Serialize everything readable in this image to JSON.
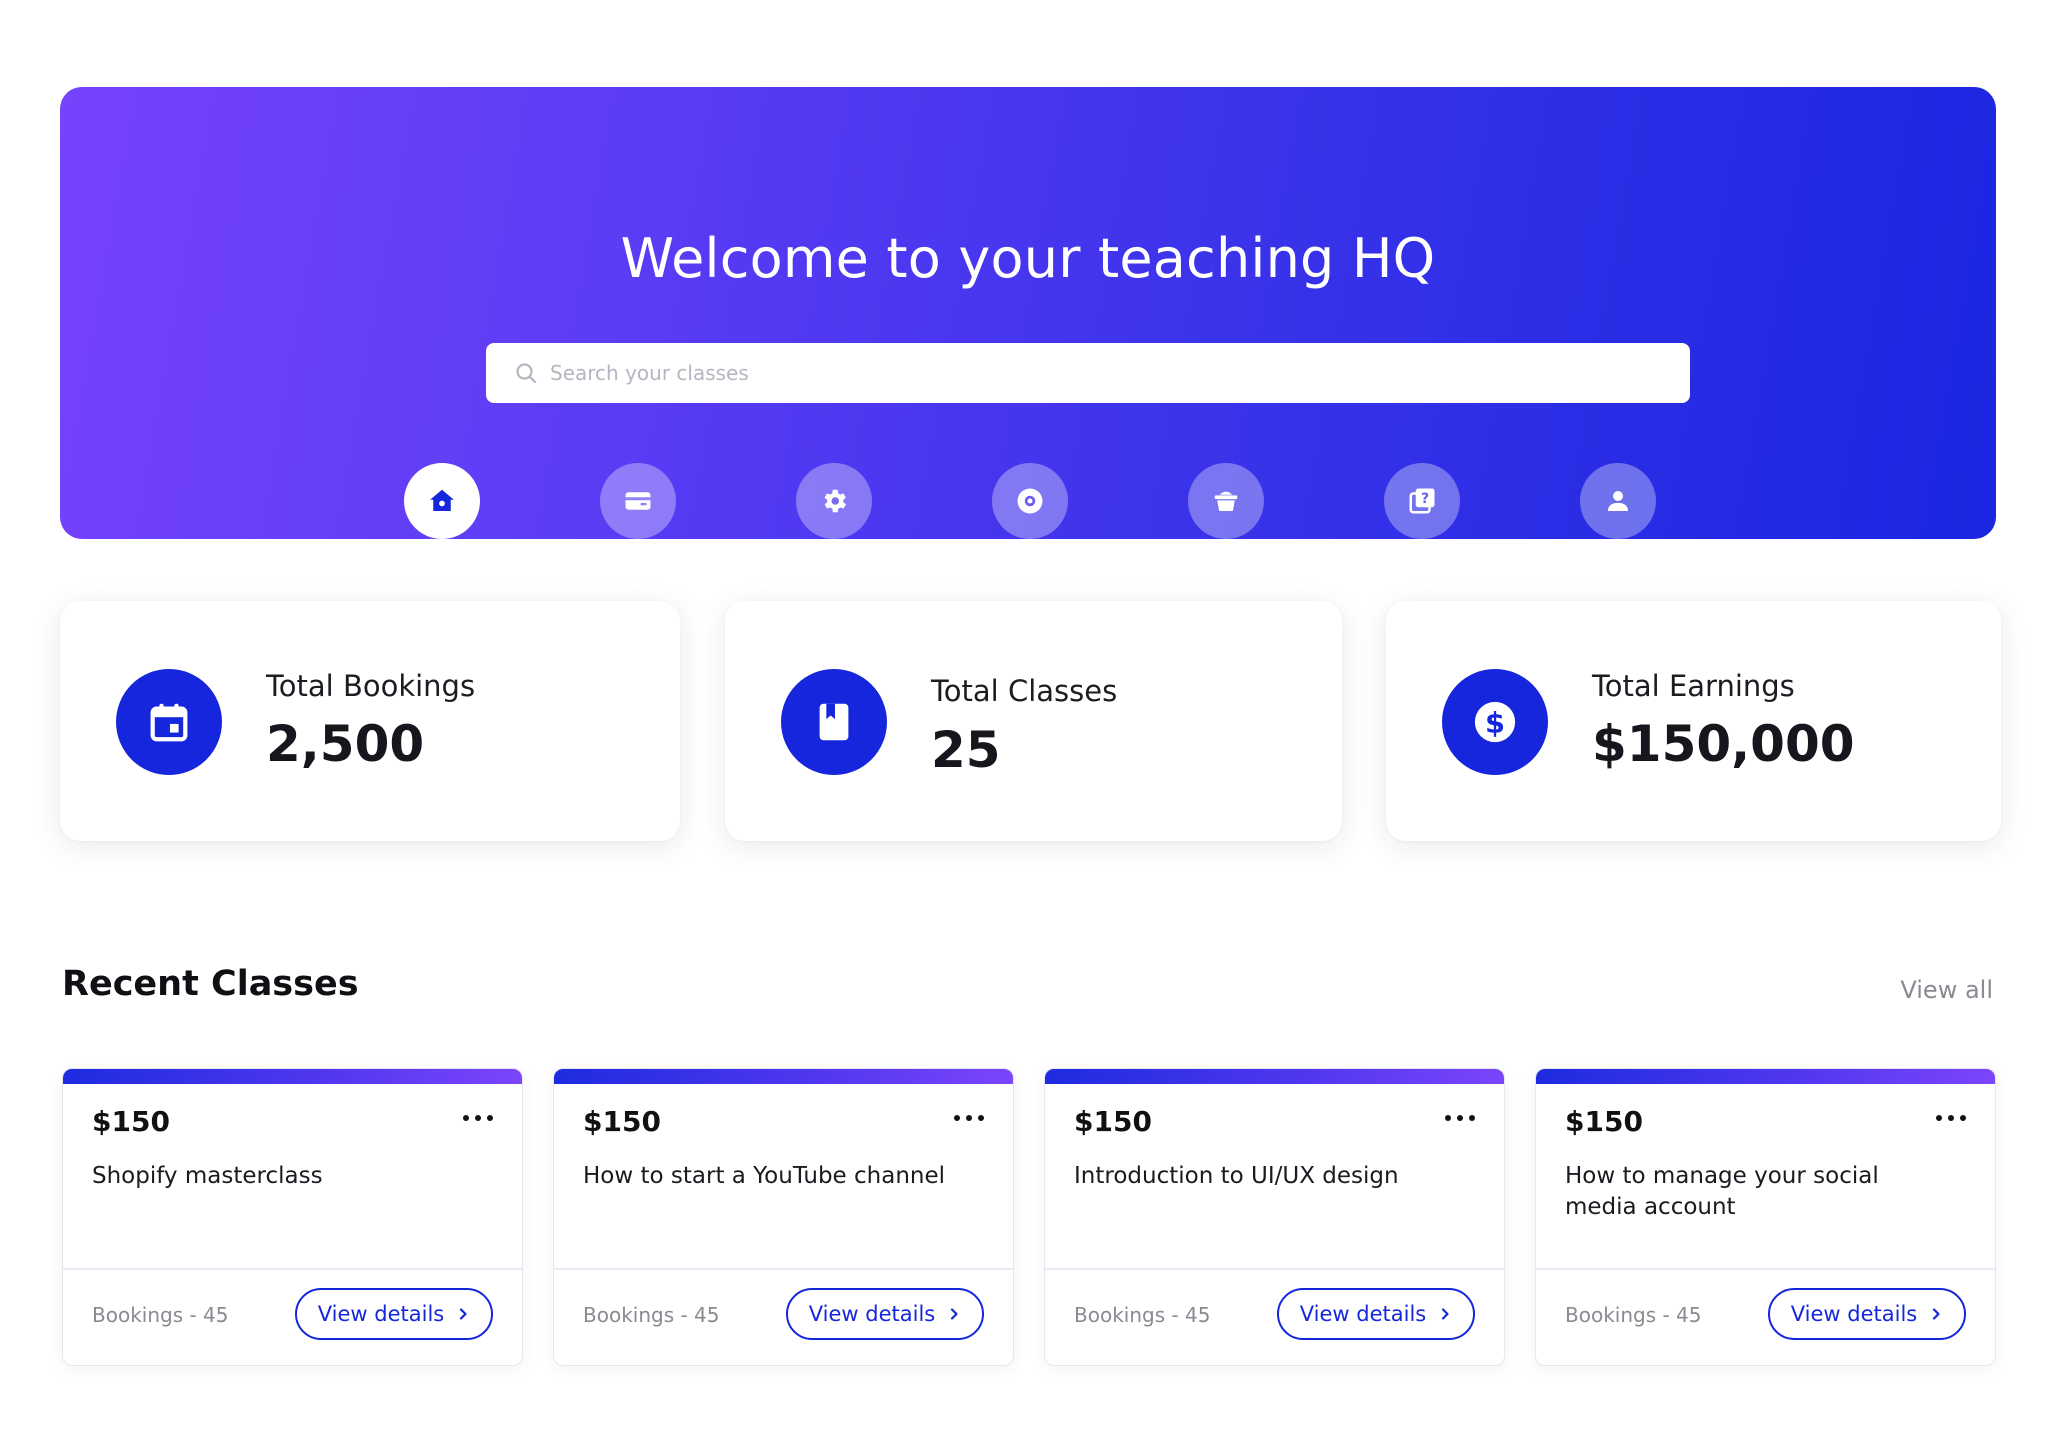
{
  "hero": {
    "title": "Welcome to your teaching HQ",
    "search_placeholder": "Search your classes"
  },
  "nav": {
    "items": [
      {
        "label": "Home",
        "icon": "home-icon",
        "active": true
      },
      {
        "label": "Payments",
        "icon": "credit-card-icon",
        "active": false
      },
      {
        "label": "Integrations",
        "icon": "gear-icon",
        "active": false
      },
      {
        "label": "Recordings",
        "icon": "record-icon",
        "active": false
      },
      {
        "label": "Resources",
        "icon": "basket-icon",
        "active": false
      },
      {
        "label": "Quizzes",
        "icon": "quiz-icon",
        "active": false
      },
      {
        "label": "Settings",
        "icon": "user-icon",
        "active": false
      }
    ]
  },
  "stats": [
    {
      "label": "Total Bookings",
      "value": "2,500",
      "icon": "calendar-icon"
    },
    {
      "label": "Total Classes",
      "value": "25",
      "icon": "book-icon"
    },
    {
      "label": "Total Earnings",
      "value": "$150,000",
      "icon": "dollar-icon"
    }
  ],
  "recent": {
    "title": "Recent Classes",
    "view_all": "View all",
    "classes": [
      {
        "price": "$150",
        "title": "Shopify masterclass",
        "bookings": "Bookings - 45",
        "button": "View details"
      },
      {
        "price": "$150",
        "title": "How to start a YouTube channel",
        "bookings": "Bookings - 45",
        "button": "View details"
      },
      {
        "price": "$150",
        "title": "Introduction to UI/UX design",
        "bookings": "Bookings - 45",
        "button": "View details"
      },
      {
        "price": "$150",
        "title": "How to manage your social media account",
        "bookings": "Bookings - 45",
        "button": "View details"
      }
    ]
  },
  "colors": {
    "accent": "#1526dc",
    "hero_gradient_start": "#7642fb",
    "hero_gradient_end": "#1a26e0"
  }
}
